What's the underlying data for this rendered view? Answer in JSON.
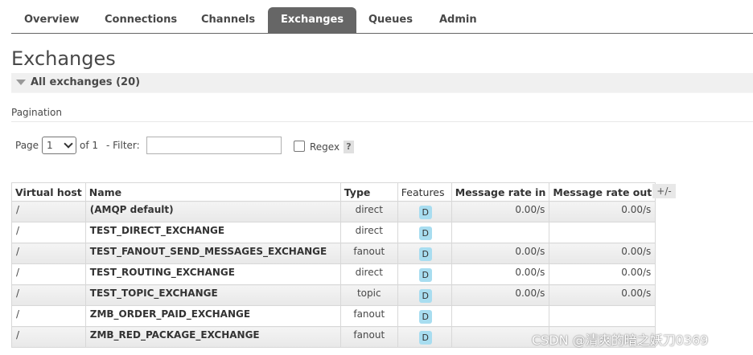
{
  "nav": {
    "tabs": [
      {
        "label": "Overview",
        "active": false
      },
      {
        "label": "Connections",
        "active": false
      },
      {
        "label": "Channels",
        "active": false
      },
      {
        "label": "Exchanges",
        "active": true
      },
      {
        "label": "Queues",
        "active": false
      },
      {
        "label": "Admin",
        "active": false
      }
    ]
  },
  "page_title": "Exchanges",
  "section": {
    "label": "All exchanges (20)"
  },
  "pagination": {
    "title": "Pagination",
    "page_label": "Page",
    "page_value": "1",
    "of_label": "of 1",
    "filter_label": "- Filter:",
    "filter_value": "",
    "regex_label": "Regex",
    "help_label": "?"
  },
  "table": {
    "columns": [
      "Virtual host",
      "Name",
      "Type",
      "Features",
      "Message rate in",
      "Message rate out"
    ],
    "toggle_label": "+/-",
    "rows": [
      {
        "vhost": "/",
        "name": "(AMQP default)",
        "type": "direct",
        "feature": "D",
        "rate_in": "0.00/s",
        "rate_out": "0.00/s"
      },
      {
        "vhost": "/",
        "name": "TEST_DIRECT_EXCHANGE",
        "type": "direct",
        "feature": "D",
        "rate_in": "",
        "rate_out": ""
      },
      {
        "vhost": "/",
        "name": "TEST_FANOUT_SEND_MESSAGES_EXCHANGE",
        "type": "fanout",
        "feature": "D",
        "rate_in": "0.00/s",
        "rate_out": "0.00/s"
      },
      {
        "vhost": "/",
        "name": "TEST_ROUTING_EXCHANGE",
        "type": "direct",
        "feature": "D",
        "rate_in": "0.00/s",
        "rate_out": "0.00/s"
      },
      {
        "vhost": "/",
        "name": "TEST_TOPIC_EXCHANGE",
        "type": "topic",
        "feature": "D",
        "rate_in": "0.00/s",
        "rate_out": "0.00/s"
      },
      {
        "vhost": "/",
        "name": "ZMB_ORDER_PAID_EXCHANGE",
        "type": "fanout",
        "feature": "D",
        "rate_in": "",
        "rate_out": ""
      },
      {
        "vhost": "/",
        "name": "ZMB_RED_PACKAGE_EXCHANGE",
        "type": "fanout",
        "feature": "D",
        "rate_in": "",
        "rate_out": ""
      }
    ]
  },
  "watermark": "CSDN @清爽的暗之妖刀0369",
  "colors": {
    "active_tab": "#666666",
    "feature_badge": "#a8ddf0"
  }
}
